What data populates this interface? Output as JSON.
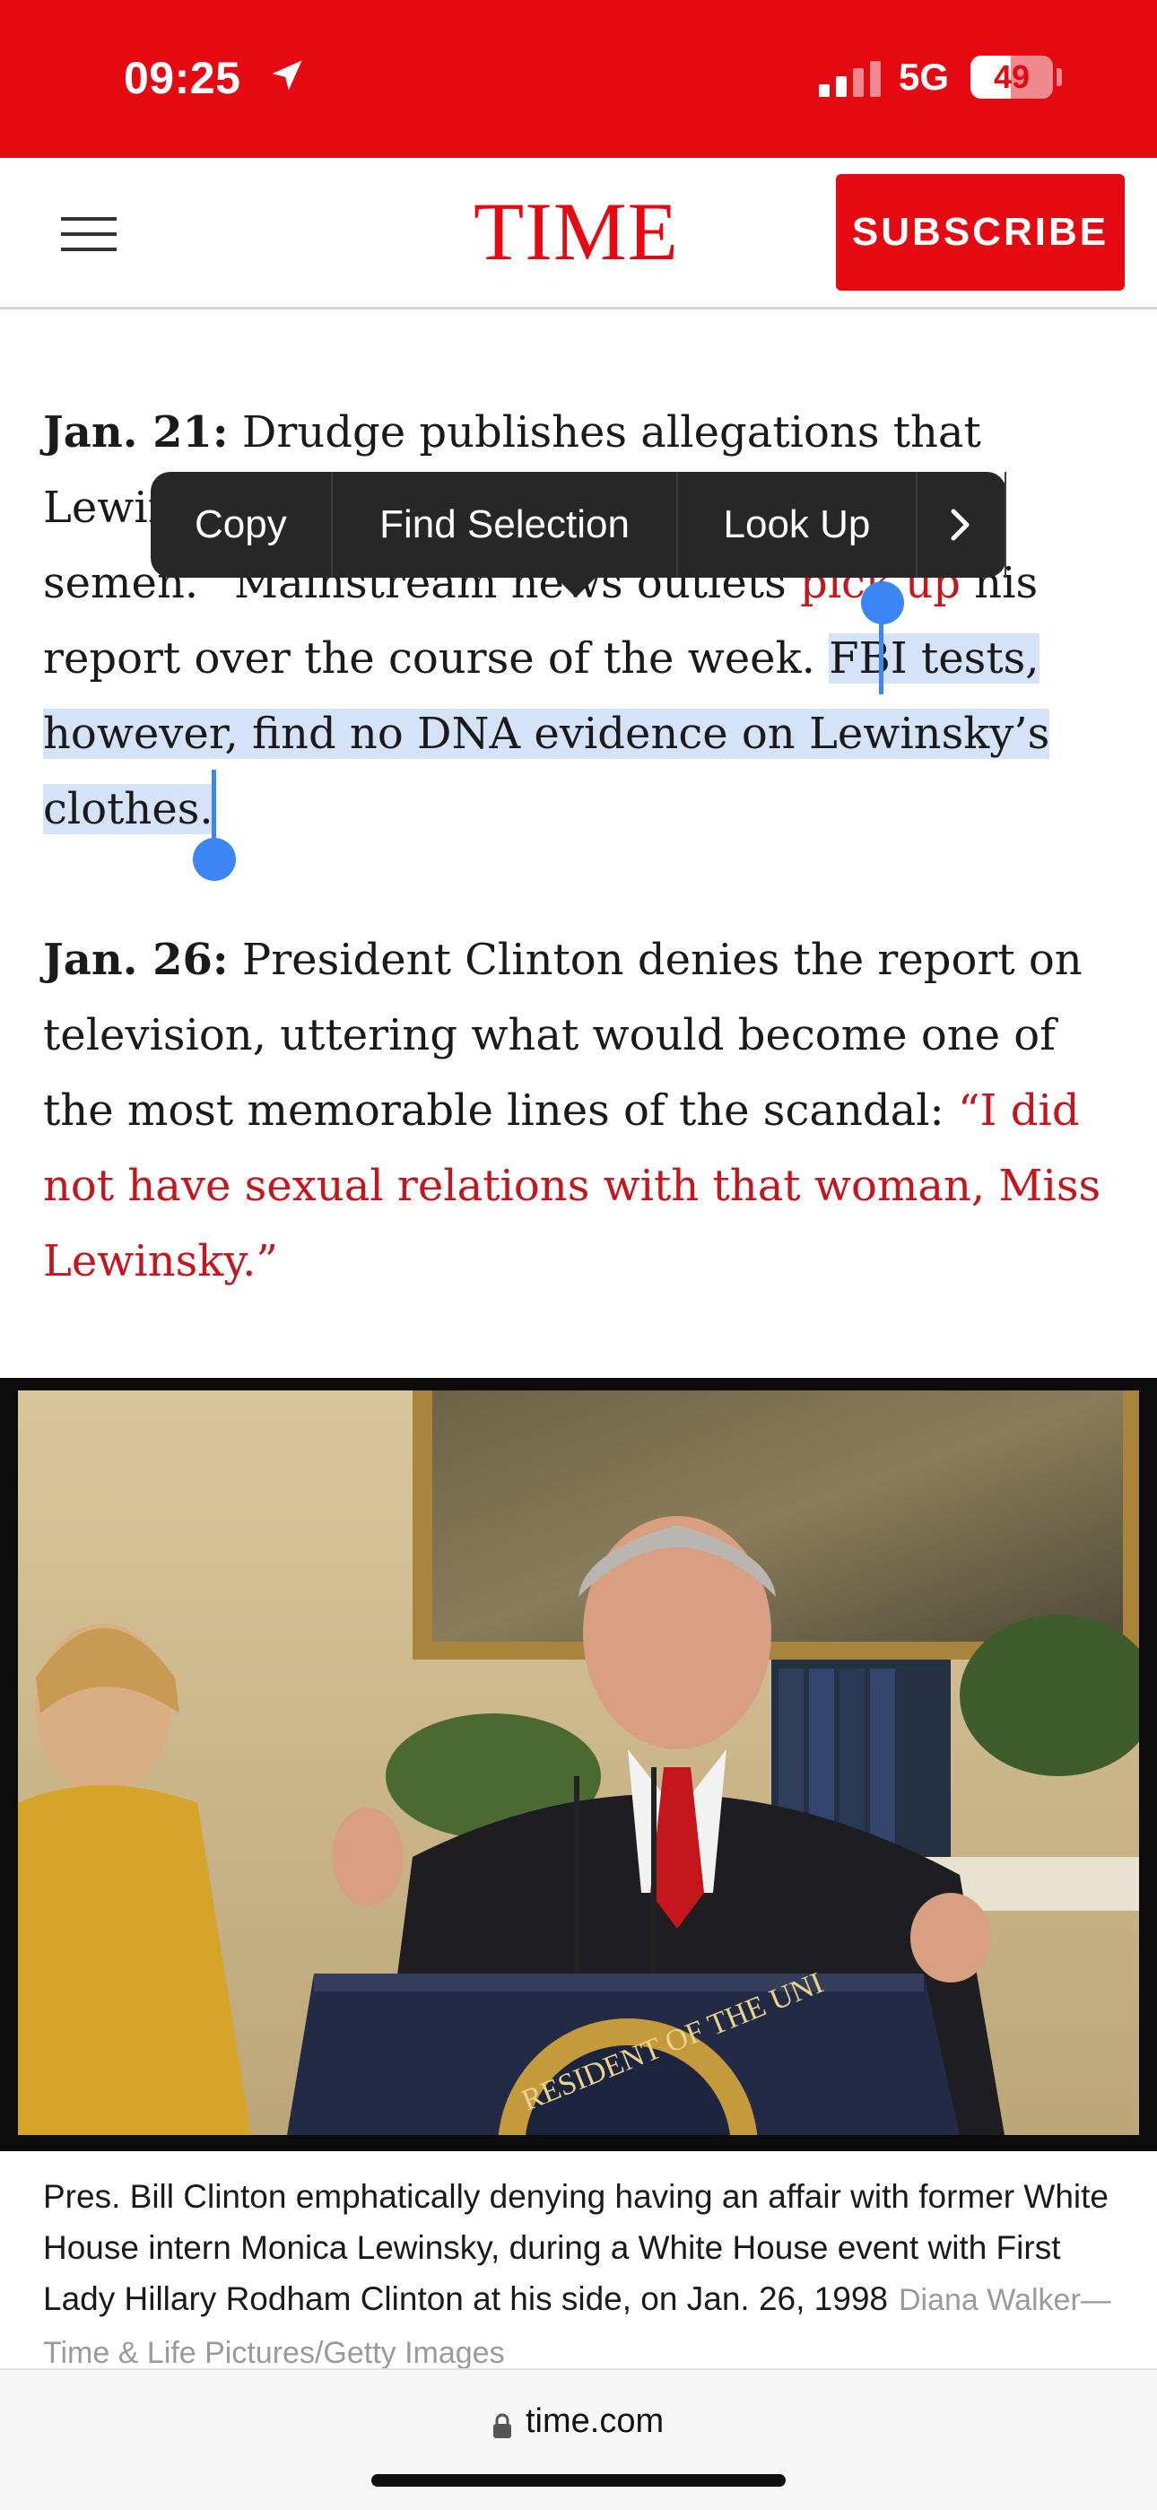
{
  "status_bar": {
    "time": "09:25",
    "network": "5G",
    "battery": "49",
    "battery_level": 0.49,
    "colors": {
      "background": "#e50a12"
    }
  },
  "header": {
    "logo": "TIME",
    "menu_icon": "hamburger-menu-icon",
    "subscribe_label": "SUBSCRIBE",
    "colors": {
      "brand": "#e50a12"
    }
  },
  "context_menu": {
    "items": [
      "Copy",
      "Find Selection",
      "Look Up"
    ],
    "more_icon": "chevron-right-icon"
  },
  "article": {
    "p1": {
      "date": "Jan. 21:",
      "t1": " Drudge publishes allegations that Lewinsky has a dress with Clinton’s “dried semen.” Mainstream news outlets ",
      "link": "pick up",
      "t2": " his report over the course of the week. ",
      "selected": "FBI tests, however, find no DNA evidence on Lewinsky’s clothes."
    },
    "p2": {
      "date": "Jan. 26:",
      "t1": " President Clinton denies the report on television, uttering what would become one of the most memorable lines of the scandal: ",
      "quote": "“I did not have sexual relations with that woman, Miss Lewinsky.”"
    },
    "colors": {
      "link": "#c4161c",
      "selection": "#d5e3f8",
      "handle": "#3b86f2"
    }
  },
  "photo": {
    "podium_seal_text": "RESIDENT OF THE UNI"
  },
  "caption": {
    "text": "Pres. Bill Clinton emphatically denying having an affair with former White House intern Monica Lewinsky, during a White House event with First Lady Hillary Rodham Clinton at his side, on Jan. 26, 1998",
    "credit": "Diana Walker—Time & Life Pictures/Getty Images"
  },
  "url_bar": {
    "url": "time.com",
    "lock_icon": "lock-icon"
  }
}
